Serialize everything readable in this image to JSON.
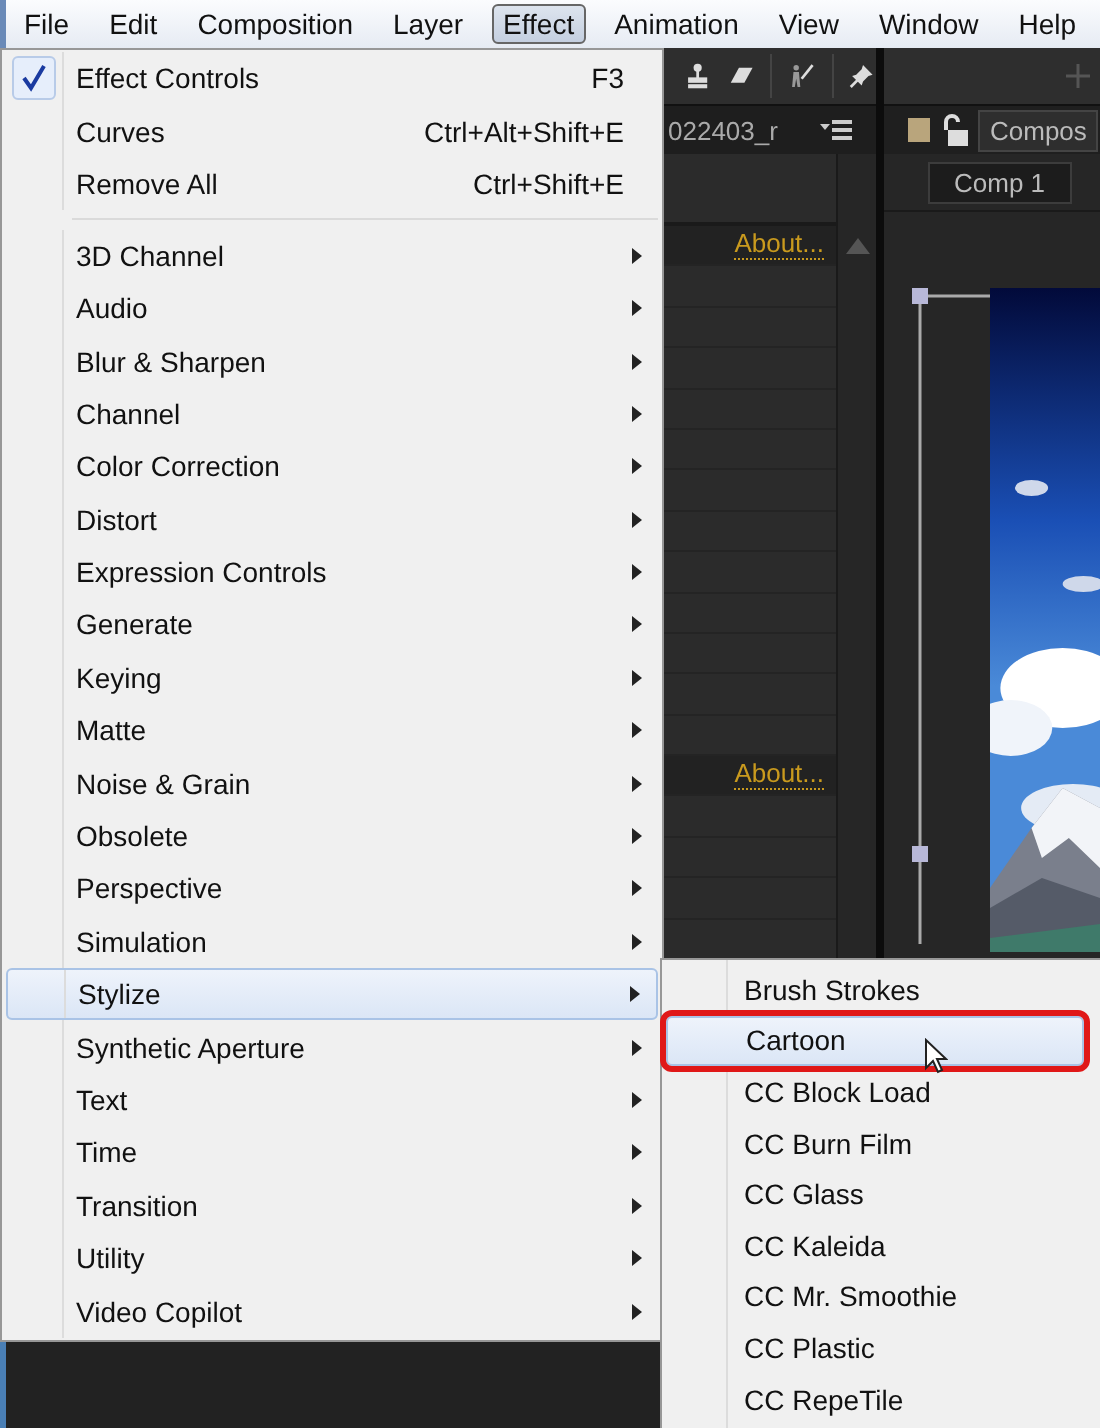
{
  "menubar": [
    {
      "label": "File",
      "selected": false
    },
    {
      "label": "Edit",
      "selected": false
    },
    {
      "label": "Composition",
      "selected": false
    },
    {
      "label": "Layer",
      "selected": false
    },
    {
      "label": "Effect",
      "selected": true
    },
    {
      "label": "Animation",
      "selected": false
    },
    {
      "label": "View",
      "selected": false
    },
    {
      "label": "Window",
      "selected": false
    },
    {
      "label": "Help",
      "selected": false
    }
  ],
  "menu": {
    "items": [
      {
        "kind": "item",
        "label": "Effect Controls",
        "shortcut": "F3",
        "checked": true
      },
      {
        "kind": "item",
        "label": "Curves",
        "shortcut": "Ctrl+Alt+Shift+E",
        "checked": false
      },
      {
        "kind": "item",
        "label": "Remove All",
        "shortcut": "Ctrl+Shift+E",
        "checked": false
      },
      {
        "kind": "separator"
      },
      {
        "kind": "submenu",
        "label": "3D Channel",
        "selected": false
      },
      {
        "kind": "submenu",
        "label": "Audio",
        "selected": false
      },
      {
        "kind": "submenu",
        "label": "Blur & Sharpen",
        "selected": false
      },
      {
        "kind": "submenu",
        "label": "Channel",
        "selected": false
      },
      {
        "kind": "submenu",
        "label": "Color Correction",
        "selected": false
      },
      {
        "kind": "submenu",
        "label": "Distort",
        "selected": false
      },
      {
        "kind": "submenu",
        "label": "Expression Controls",
        "selected": false
      },
      {
        "kind": "submenu",
        "label": "Generate",
        "selected": false
      },
      {
        "kind": "submenu",
        "label": "Keying",
        "selected": false
      },
      {
        "kind": "submenu",
        "label": "Matte",
        "selected": false
      },
      {
        "kind": "submenu",
        "label": "Noise & Grain",
        "selected": false
      },
      {
        "kind": "submenu",
        "label": "Obsolete",
        "selected": false
      },
      {
        "kind": "submenu",
        "label": "Perspective",
        "selected": false
      },
      {
        "kind": "submenu",
        "label": "Simulation",
        "selected": false
      },
      {
        "kind": "submenu",
        "label": "Stylize",
        "selected": true
      },
      {
        "kind": "submenu",
        "label": "Synthetic Aperture",
        "selected": false
      },
      {
        "kind": "submenu",
        "label": "Text",
        "selected": false
      },
      {
        "kind": "submenu",
        "label": "Time",
        "selected": false
      },
      {
        "kind": "submenu",
        "label": "Transition",
        "selected": false
      },
      {
        "kind": "submenu",
        "label": "Utility",
        "selected": false
      },
      {
        "kind": "submenu",
        "label": "Video Copilot",
        "selected": false
      }
    ]
  },
  "submenu": {
    "items": [
      {
        "label": "Brush Strokes",
        "selected": false,
        "annotated": false
      },
      {
        "label": "Cartoon",
        "selected": true,
        "annotated": true
      },
      {
        "label": "CC Block Load",
        "selected": false,
        "annotated": false
      },
      {
        "label": "CC Burn Film",
        "selected": false,
        "annotated": false
      },
      {
        "label": "CC Glass",
        "selected": false,
        "annotated": false
      },
      {
        "label": "CC Kaleida",
        "selected": false,
        "annotated": false
      },
      {
        "label": "CC Mr. Smoothie",
        "selected": false,
        "annotated": false
      },
      {
        "label": "CC Plastic",
        "selected": false,
        "annotated": false
      },
      {
        "label": "CC RepeTile",
        "selected": false,
        "annotated": false
      }
    ]
  },
  "effects_panel": {
    "tab": "022403_r",
    "effects": [
      {
        "link": "About..."
      },
      {
        "link": "About..."
      }
    ]
  },
  "composition_panel": {
    "tab": "Compos",
    "button": "Comp 1"
  }
}
